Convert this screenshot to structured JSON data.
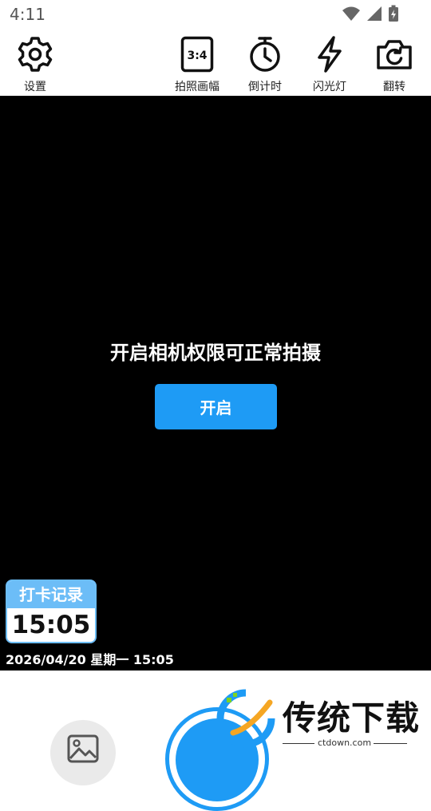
{
  "status": {
    "time": "4:11"
  },
  "toolbar": {
    "settings_label": "设置",
    "ratio_icon_text": "3:4",
    "ratio_label": "拍照画幅",
    "timer_label": "倒计时",
    "flash_label": "闪光灯",
    "flip_label": "翻转"
  },
  "camera": {
    "permission_text": "开启相机权限可正常拍摄",
    "open_button": "开启"
  },
  "punch_card": {
    "title": "打卡记录",
    "time": "15:05",
    "datetime": "2026/04/20 星期一 15:05"
  },
  "watermark": {
    "title": "传统下载",
    "site": "ctdown.com"
  },
  "colors": {
    "accent": "#1E9BF5",
    "card_header": "#6CBDF7",
    "viewfinder": "#000000"
  }
}
